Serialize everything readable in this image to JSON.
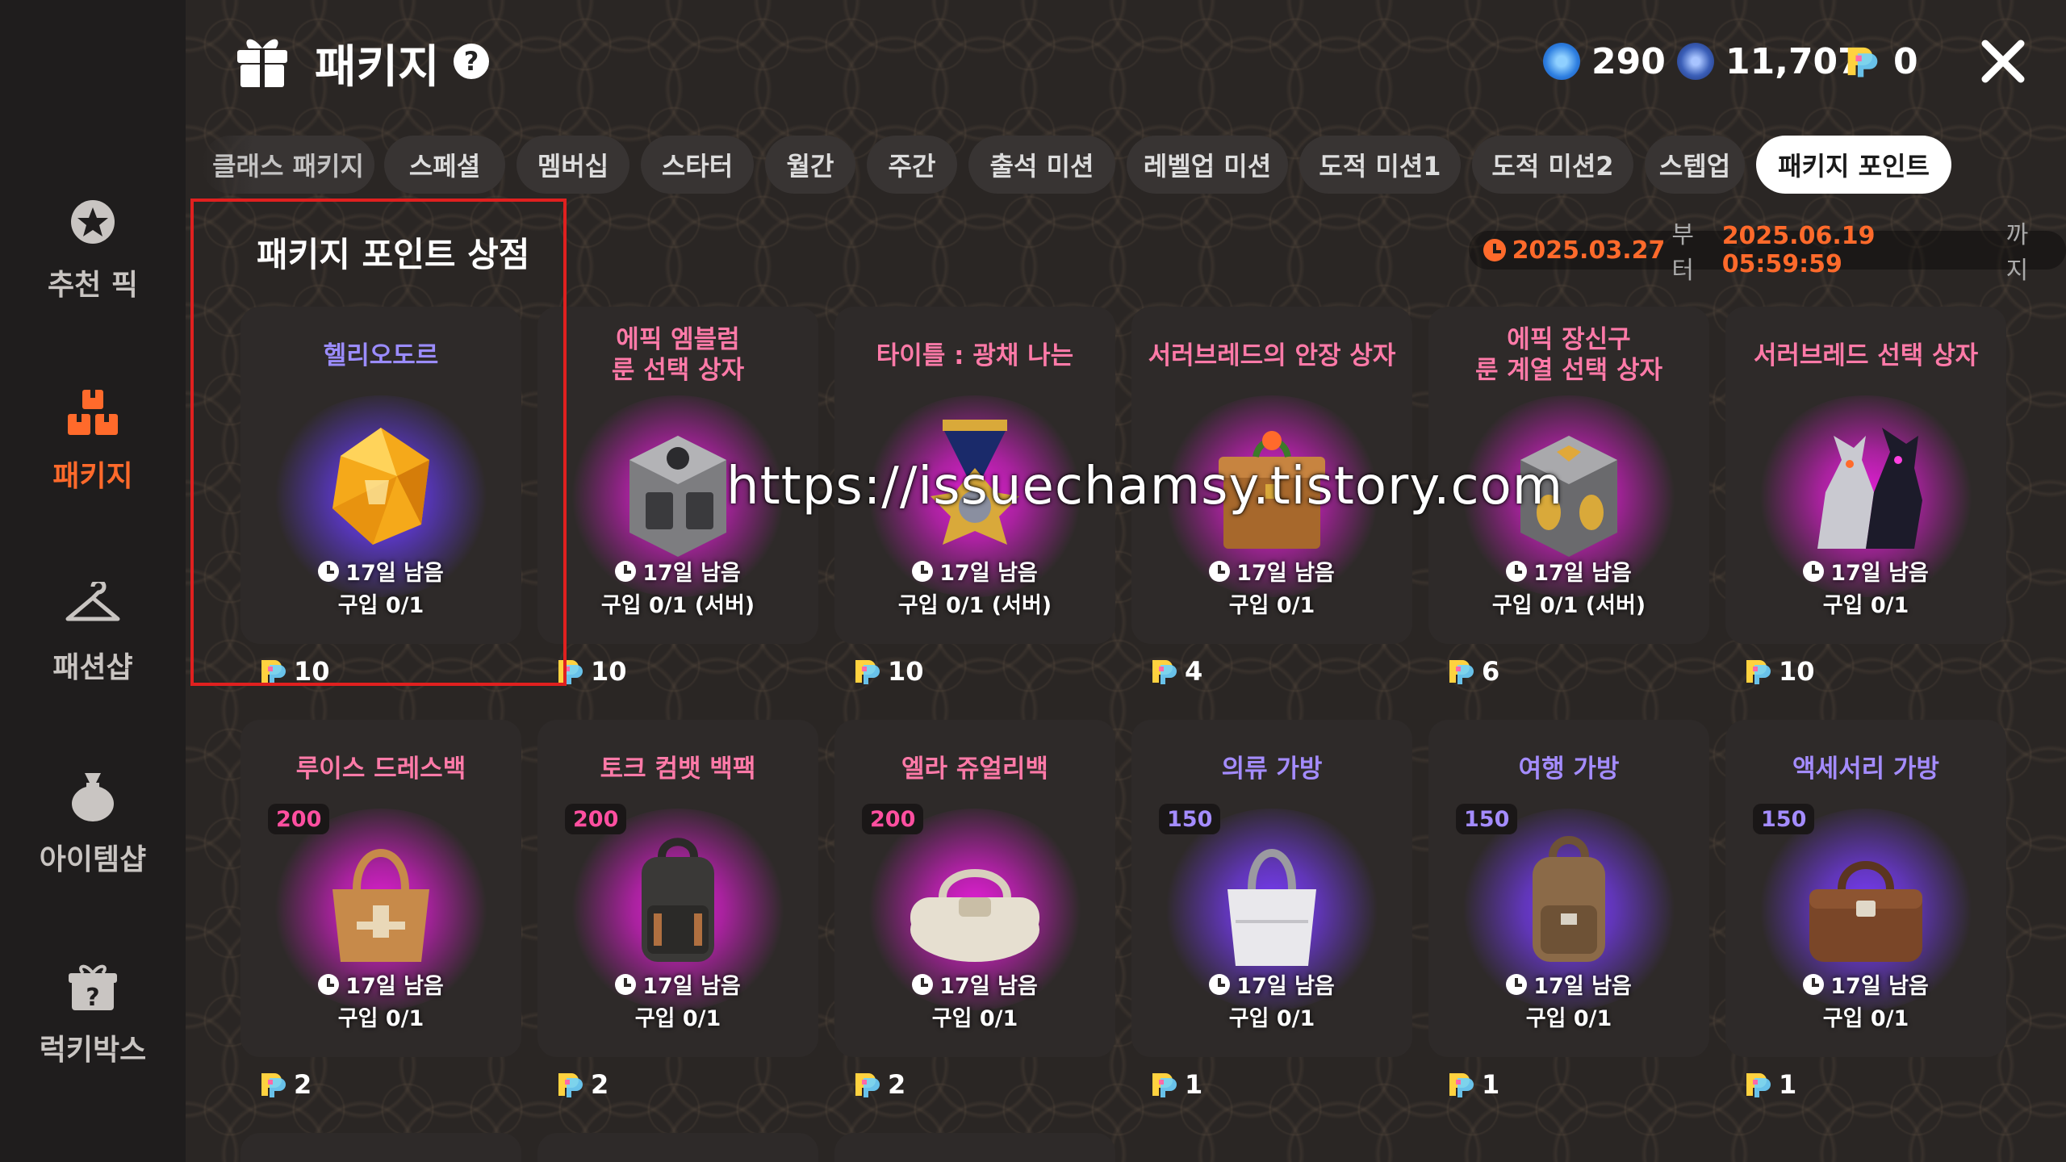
{
  "header": {
    "title": "패키지",
    "help": "?",
    "currencies": [
      {
        "icon": "blue-gem-icon",
        "value": "290"
      },
      {
        "icon": "silver-coin-icon",
        "value": "11,707"
      },
      {
        "icon": "package-point-icon",
        "value": "0"
      }
    ]
  },
  "sidebar": {
    "items": [
      {
        "label": "추천 픽",
        "icon": "star-badge-icon"
      },
      {
        "label": "패키지",
        "icon": "package-boxes-icon"
      },
      {
        "label": "패션샵",
        "icon": "hanger-icon"
      },
      {
        "label": "아이템샵",
        "icon": "money-bag-icon"
      },
      {
        "label": "럭키박스",
        "icon": "mystery-box-icon"
      }
    ]
  },
  "tabs": [
    {
      "label": "클래스 패키지"
    },
    {
      "label": "스페셜"
    },
    {
      "label": "멤버십"
    },
    {
      "label": "스타터"
    },
    {
      "label": "월간"
    },
    {
      "label": "주간"
    },
    {
      "label": "출석 미션"
    },
    {
      "label": "레벨업 미션"
    },
    {
      "label": "도적 미션1"
    },
    {
      "label": "도적 미션2"
    },
    {
      "label": "스텝업"
    },
    {
      "label": "패키지 포인트"
    }
  ],
  "section": {
    "title": "패키지 포인트 상점",
    "period_start": "2025.03.27",
    "period_mid": "부터 ",
    "period_end": "2025.06.19 05:59:59",
    "period_tail": "까지"
  },
  "cards": [
    {
      "name": "헬리오도르",
      "remain": "17일 남음",
      "buy": "구입 0/1",
      "price": "10",
      "name_color": "#9b8cff",
      "glow": "#6a3cff",
      "art": "gem-icon"
    },
    {
      "name": "에픽 엠블럼\n룬 선택 상자",
      "remain": "17일 남음",
      "buy": "구입 0/1 (서버)",
      "price": "10",
      "name_color": "#ff7aa8",
      "glow": "#e51ed8",
      "art": "stone-chest-icon"
    },
    {
      "name": "타이틀 : 광채 나는",
      "remain": "17일 남음",
      "buy": "구입 0/1 (서버)",
      "price": "10",
      "name_color": "#ff7aa8",
      "glow": "#e51ed8",
      "art": "medal-icon"
    },
    {
      "name": "서러브레드의 안장 상자",
      "remain": "17일 남음",
      "buy": "구입 0/1",
      "price": "4",
      "name_color": "#ff7aa8",
      "glow": "#e51ed8",
      "art": "basket-chest-icon"
    },
    {
      "name": "에픽 장신구\n룬 계열 선택 상자",
      "remain": "17일 남음",
      "buy": "구입 0/1 (서버)",
      "price": "6",
      "name_color": "#ff7aa8",
      "glow": "#e51ed8",
      "art": "gold-chest-icon"
    },
    {
      "name": "서러브레드 선택 상자",
      "remain": "17일 남음",
      "buy": "구입 0/1",
      "price": "10",
      "name_color": "#ff7aa8",
      "glow": "#e51ed8",
      "art": "horse-icon"
    },
    {
      "name": "루이스 드레스백",
      "badge": "200",
      "badge_color": "#ff4fa0",
      "remain": "17일 남음",
      "buy": "구입 0/1",
      "price": "2",
      "name_color": "#ff7aa8",
      "glow": "#e51ed8",
      "art": "handbag-icon"
    },
    {
      "name": "토크 컴뱃 백팩",
      "badge": "200",
      "badge_color": "#ff4fa0",
      "remain": "17일 남음",
      "buy": "구입 0/1",
      "price": "2",
      "name_color": "#ff7aa8",
      "glow": "#e51ed8",
      "art": "backpack-icon"
    },
    {
      "name": "엘라 쥬얼리백",
      "badge": "200",
      "badge_color": "#ff4fa0",
      "remain": "17일 남음",
      "buy": "구입 0/1",
      "price": "2",
      "name_color": "#ff7aa8",
      "glow": "#e51ed8",
      "art": "duffel-bag-icon"
    },
    {
      "name": "의류 가방",
      "badge": "150",
      "badge_color": "#a48cff",
      "remain": "17일 남음",
      "buy": "구입 0/1",
      "price": "1",
      "name_color": "#a48cff",
      "glow": "#7a3cff",
      "art": "tote-bag-icon"
    },
    {
      "name": "여행 가방",
      "badge": "150",
      "badge_color": "#a48cff",
      "remain": "17일 남음",
      "buy": "구입 0/1",
      "price": "1",
      "name_color": "#a48cff",
      "glow": "#7a3cff",
      "art": "travel-backpack-icon"
    },
    {
      "name": "액세서리 가방",
      "badge": "150",
      "badge_color": "#a48cff",
      "remain": "17일 남음",
      "buy": "구입 0/1",
      "price": "1",
      "name_color": "#a48cff",
      "glow": "#7a3cff",
      "art": "leather-bag-icon"
    }
  ],
  "watermark": "https://issuechamsy.tistory.com",
  "colors": {
    "accent": "#ff6a2b",
    "highlight_border": "#e0201f"
  }
}
